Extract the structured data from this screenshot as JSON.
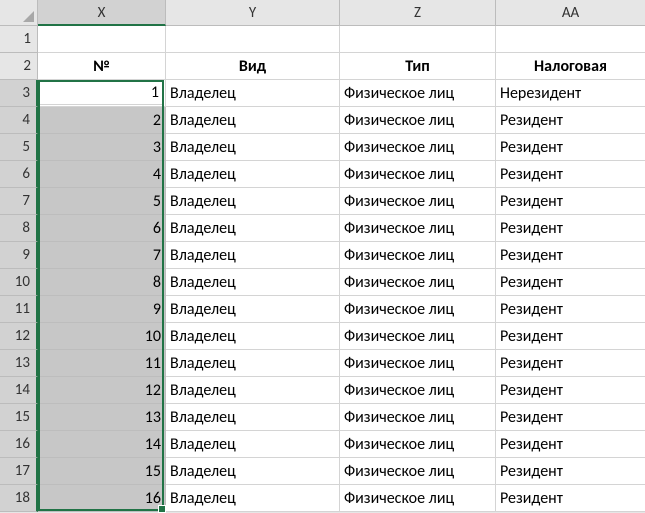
{
  "columns": [
    {
      "letter": "X",
      "width": 128,
      "active": true
    },
    {
      "letter": "Y",
      "width": 174,
      "active": false
    },
    {
      "letter": "Z",
      "width": 156,
      "active": false
    },
    {
      "letter": "AA",
      "width": 150,
      "active": false
    }
  ],
  "row_count": 18,
  "active_rows_from": 3,
  "active_rows_to": 18,
  "headers": {
    "x": "№",
    "y": "Вид",
    "z": "Тип",
    "aa": "Налоговая"
  },
  "data": [
    {
      "n": "1",
      "vid": "Владелец",
      "tip": "Физическое лиц",
      "nal": "Нерезидент"
    },
    {
      "n": "2",
      "vid": "Владелец",
      "tip": "Физическое лиц",
      "nal": "Резидент"
    },
    {
      "n": "3",
      "vid": "Владелец",
      "tip": "Физическое лиц",
      "nal": "Резидент"
    },
    {
      "n": "4",
      "vid": "Владелец",
      "tip": "Физическое лиц",
      "nal": "Резидент"
    },
    {
      "n": "5",
      "vid": "Владелец",
      "tip": "Физическое лиц",
      "nal": "Резидент"
    },
    {
      "n": "6",
      "vid": "Владелец",
      "tip": "Физическое лиц",
      "nal": "Резидент"
    },
    {
      "n": "7",
      "vid": "Владелец",
      "tip": "Физическое лиц",
      "nal": "Резидент"
    },
    {
      "n": "8",
      "vid": "Владелец",
      "tip": "Физическое лиц",
      "nal": "Резидент"
    },
    {
      "n": "9",
      "vid": "Владелец",
      "tip": "Физическое лиц",
      "nal": "Резидент"
    },
    {
      "n": "10",
      "vid": "Владелец",
      "tip": "Физическое лиц",
      "nal": "Резидент"
    },
    {
      "n": "11",
      "vid": "Владелец",
      "tip": "Физическое лиц",
      "nal": "Резидент"
    },
    {
      "n": "12",
      "vid": "Владелец",
      "tip": "Физическое лиц",
      "nal": "Резидент"
    },
    {
      "n": "13",
      "vid": "Владелец",
      "tip": "Физическое лиц",
      "nal": "Резидент"
    },
    {
      "n": "14",
      "vid": "Владелец",
      "tip": "Физическое лиц",
      "nal": "Резидент"
    },
    {
      "n": "15",
      "vid": "Владелец",
      "tip": "Физическое лиц",
      "nal": "Резидент"
    },
    {
      "n": "16",
      "vid": "Владелец",
      "tip": "Физическое лиц",
      "nal": "Резидент"
    }
  ],
  "selection": {
    "top_row": 3,
    "bottom_row": 18,
    "col": 0,
    "active_cell_row": 3
  }
}
